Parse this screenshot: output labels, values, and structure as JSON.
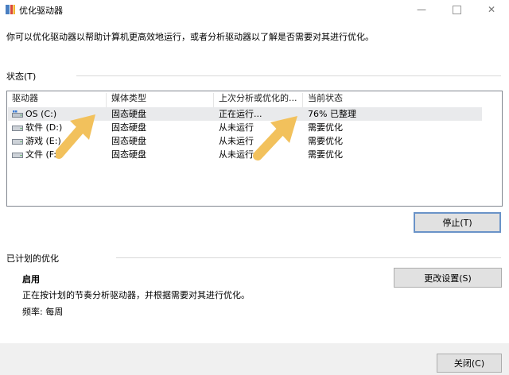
{
  "window": {
    "title": "优化驱动器",
    "minimize_glyph": "—",
    "close_glyph": "✕"
  },
  "description": "你可以优化驱动器以帮助计算机更高效地运行，或者分析驱动器以了解是否需要对其进行优化。",
  "status_section": {
    "label": "状态(T)",
    "columns": [
      "驱动器",
      "媒体类型",
      "上次分析或优化的...",
      "当前状态"
    ],
    "rows": [
      {
        "drive": "OS (C:)",
        "media": "固态硬盘",
        "last": "正在运行...",
        "status": "76% 已整理",
        "icon": "windows-drive-icon",
        "selected": true
      },
      {
        "drive": "软件 (D:)",
        "media": "固态硬盘",
        "last": "从未运行",
        "status": "需要优化",
        "icon": "drive-icon",
        "selected": false
      },
      {
        "drive": "游戏 (E:)",
        "media": "固态硬盘",
        "last": "从未运行",
        "status": "需要优化",
        "icon": "drive-icon",
        "selected": false
      },
      {
        "drive": "文件 (F:)",
        "media": "固态硬盘",
        "last": "从未运行",
        "status": "需要优化",
        "icon": "drive-icon",
        "selected": false
      }
    ],
    "stop_button": "停止(T)"
  },
  "scheduled_section": {
    "label": "已计划的优化",
    "state": "启用",
    "detail": "正在按计划的节奏分析驱动器，并根据需要对其进行优化。",
    "frequency": "频率: 每周",
    "change_settings_button": "更改设置(S)"
  },
  "footer": {
    "close_button": "关闭(C)"
  },
  "colors": {
    "selected_row": "#e9eaec",
    "button_bg": "#e1e1e1",
    "focus_border": "#6a93c8",
    "footer_bg": "#f0f0f0",
    "annotation_arrow": "#f2c15c"
  }
}
